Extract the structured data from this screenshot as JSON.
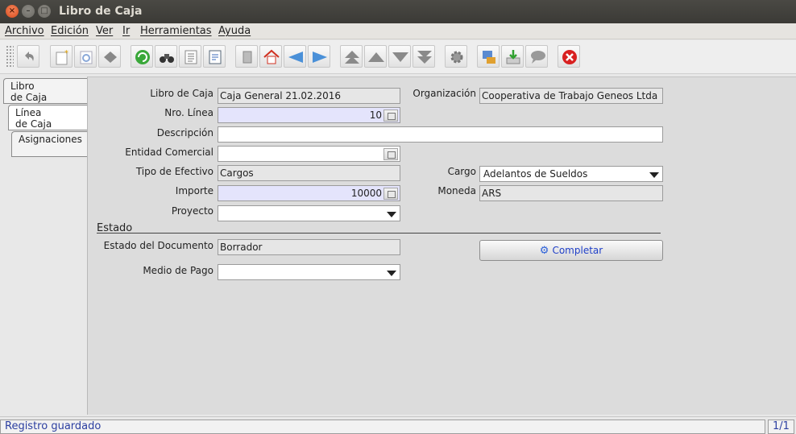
{
  "window": {
    "title": "Libro de Caja"
  },
  "menu": [
    "Archivo",
    "Edición",
    "Ver",
    "Ir",
    "Herramientas",
    "Ayuda"
  ],
  "toolbar": {
    "icons": [
      "undo-icon",
      "new-record-icon",
      "copy-record-icon",
      "delete-icon",
      "refresh-icon",
      "find-icon",
      "history-icon",
      "report-icon",
      "attachment-icon",
      "home-icon",
      "previous-icon",
      "next-icon",
      "first-record-icon",
      "previous-record-icon",
      "next-record-icon",
      "last-record-icon",
      "process-icon",
      "print-icon",
      "export-icon",
      "chat-icon",
      "exit-icon"
    ]
  },
  "tabs": {
    "t0_line1": "Libro",
    "t0_line2": "de Caja",
    "t1_line1": "Línea",
    "t1_line2": "de Caja",
    "t2": "Asignaciones"
  },
  "form": {
    "libro_label": "Libro de Caja",
    "libro_value": "Caja General 21.02.2016",
    "org_label": "Organización",
    "org_value": "Cooperativa de Trabajo Geneos Ltda",
    "linea_label": "Nro. Línea",
    "linea_value": "10",
    "desc_label": "Descripción",
    "desc_value": "",
    "entidad_label": "Entidad Comercial",
    "entidad_value": "",
    "tipo_label": "Tipo de Efectivo",
    "tipo_value": "Cargos",
    "cargo_label": "Cargo",
    "cargo_value": "Adelantos de Sueldos",
    "importe_label": "Importe",
    "importe_value": "10000",
    "moneda_label": "Moneda",
    "moneda_value": "ARS",
    "proyecto_label": "Proyecto",
    "proyecto_value": "",
    "estado_section": "Estado",
    "estado_doc_label": "Estado del Documento",
    "estado_doc_value": "Borrador",
    "completar_label": "Completar",
    "medio_label": "Medio de Pago",
    "medio_value": ""
  },
  "status": {
    "message": "Registro guardado",
    "count": "1/1"
  },
  "colors": {
    "required_field": "#e4e4fc",
    "titlebar": "#3b3a36",
    "close_button": "#e0572a"
  }
}
